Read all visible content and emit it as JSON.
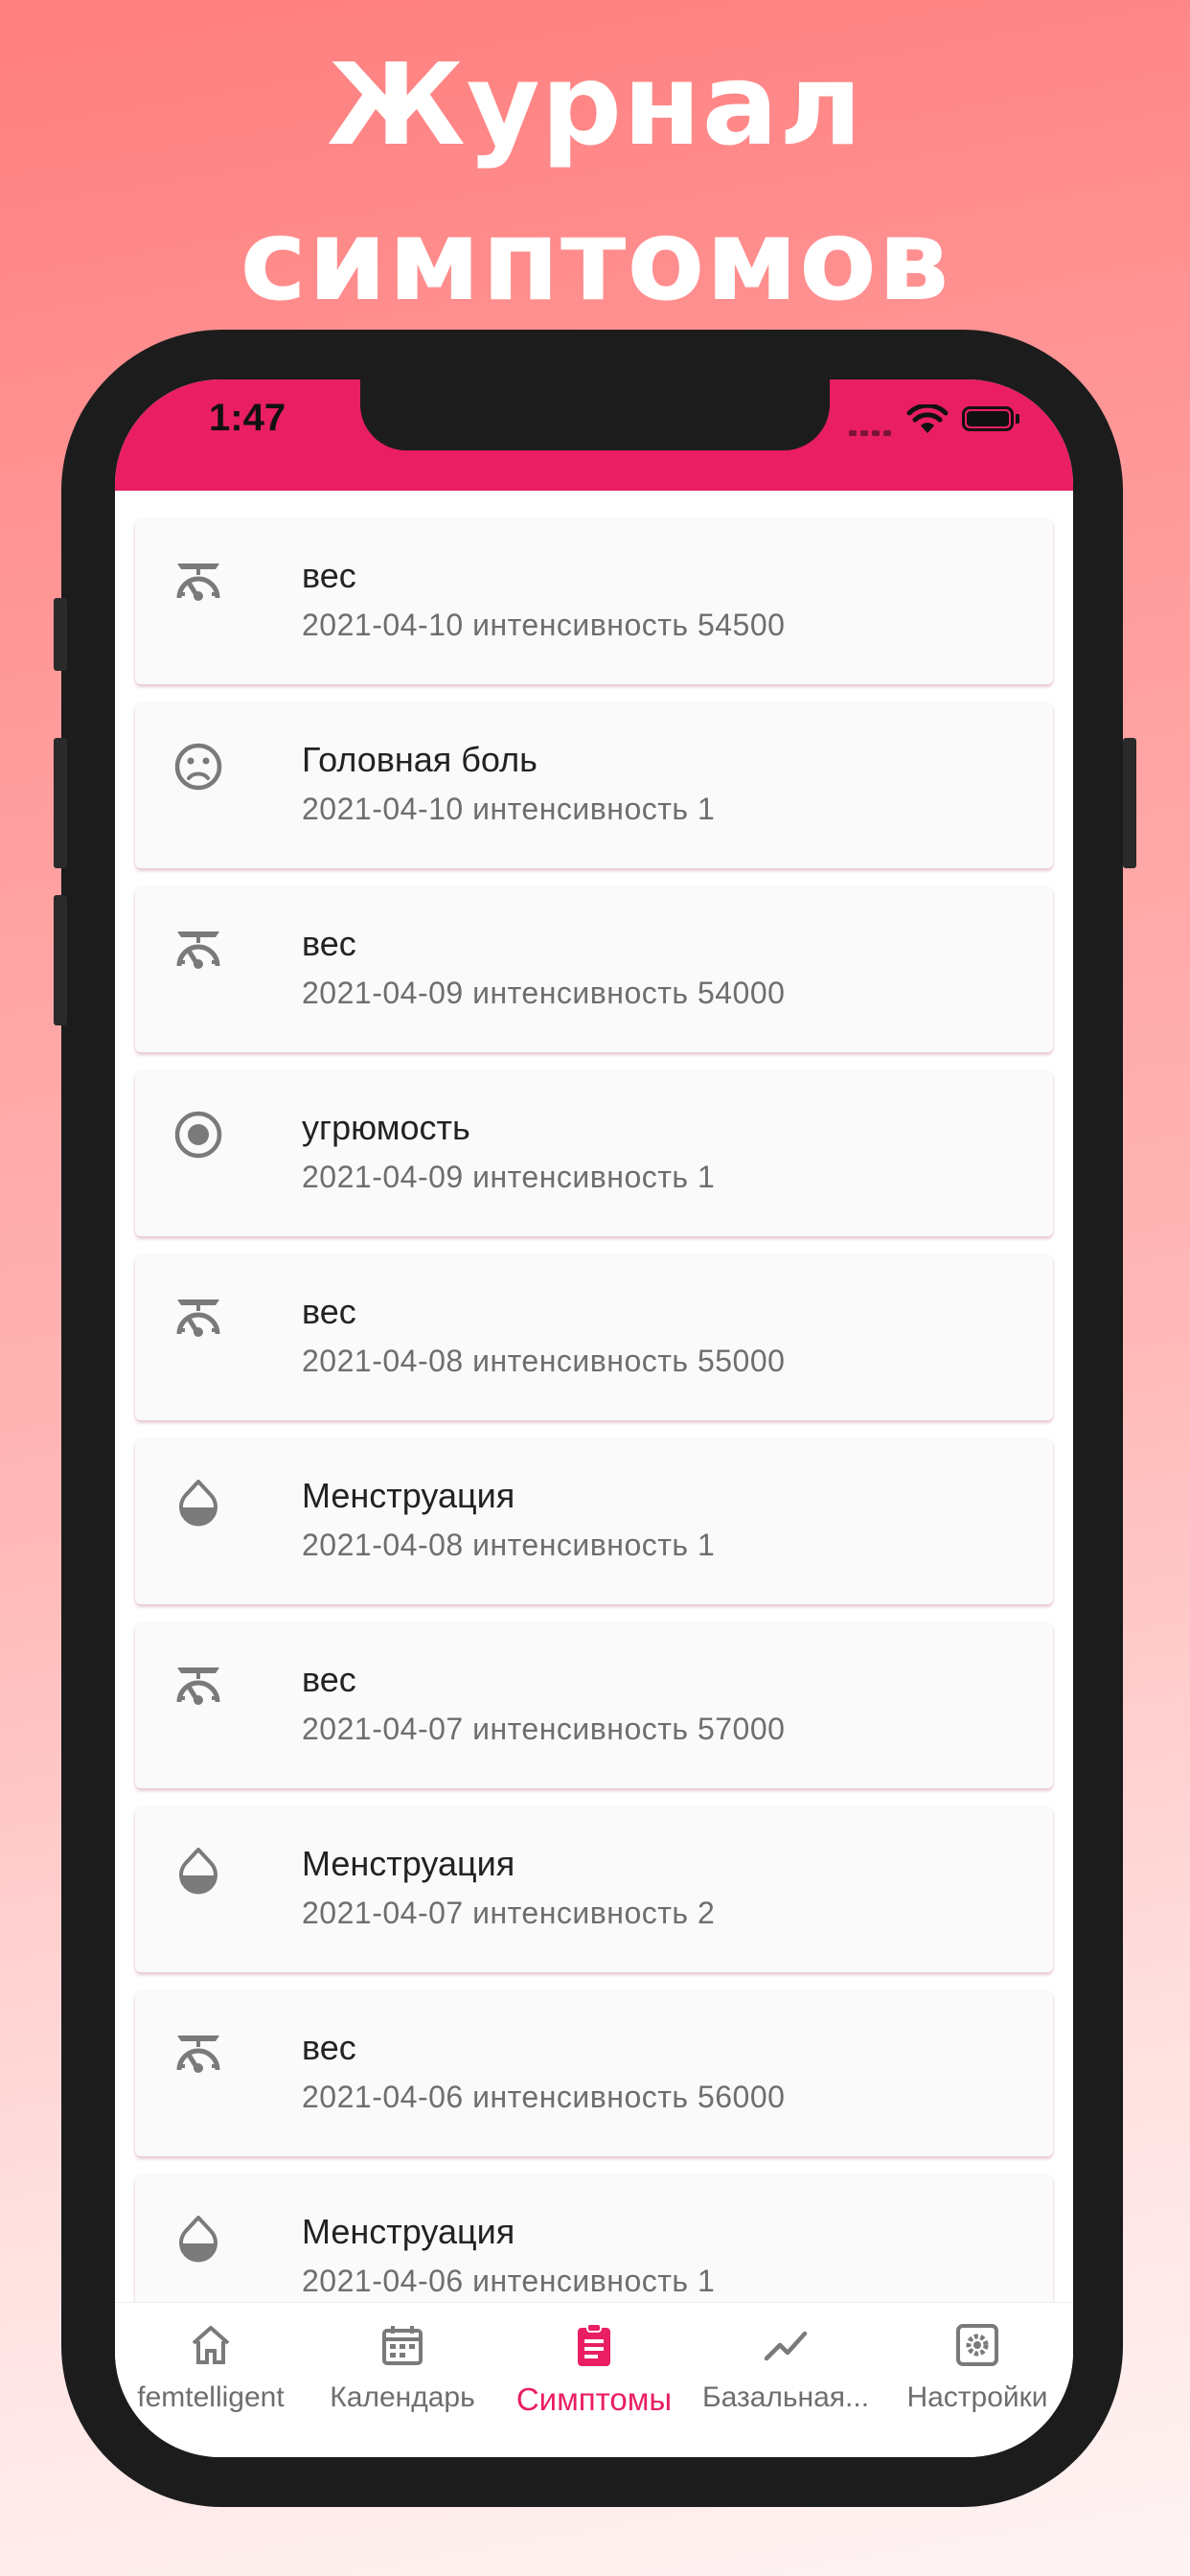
{
  "headline": {
    "line1": "Журнал",
    "line2": "симптомов"
  },
  "status_bar": {
    "time": "1:47"
  },
  "colors": {
    "accent": "#e91e63",
    "icon_gray": "#7a7a7a",
    "text_secondary": "#6e6e6e"
  },
  "symptoms": [
    {
      "icon": "scale-icon",
      "title": "вес",
      "subtitle": "2021-04-10 интенсивность 54500"
    },
    {
      "icon": "sad-face-icon",
      "title": "Головная боль",
      "subtitle": "2021-04-10 интенсивность 1"
    },
    {
      "icon": "scale-icon",
      "title": "вес",
      "subtitle": "2021-04-09 интенсивность 54000"
    },
    {
      "icon": "radio-circle-icon",
      "title": "угрюмость",
      "subtitle": "2021-04-09 интенсивность 1"
    },
    {
      "icon": "scale-icon",
      "title": "вес",
      "subtitle": "2021-04-08 интенсивность 55000"
    },
    {
      "icon": "drop-icon",
      "title": "Менструация",
      "subtitle": "2021-04-08 интенсивность 1"
    },
    {
      "icon": "scale-icon",
      "title": "вес",
      "subtitle": "2021-04-07 интенсивность 57000"
    },
    {
      "icon": "drop-icon",
      "title": "Менструация",
      "subtitle": "2021-04-07 интенсивность 2"
    },
    {
      "icon": "scale-icon",
      "title": "вес",
      "subtitle": "2021-04-06 интенсивность 56000"
    },
    {
      "icon": "drop-icon",
      "title": "Менструация",
      "subtitle": "2021-04-06 интенсивность 1"
    }
  ],
  "tabs": [
    {
      "icon": "home-icon",
      "label": "femtelligent",
      "active": false
    },
    {
      "icon": "calendar-icon",
      "label": "Календарь",
      "active": false
    },
    {
      "icon": "clipboard-icon",
      "label": "Симптомы",
      "active": true
    },
    {
      "icon": "trending-line-icon",
      "label": "Базальная...",
      "active": false
    },
    {
      "icon": "settings-icon",
      "label": "Настройки",
      "active": false
    }
  ]
}
